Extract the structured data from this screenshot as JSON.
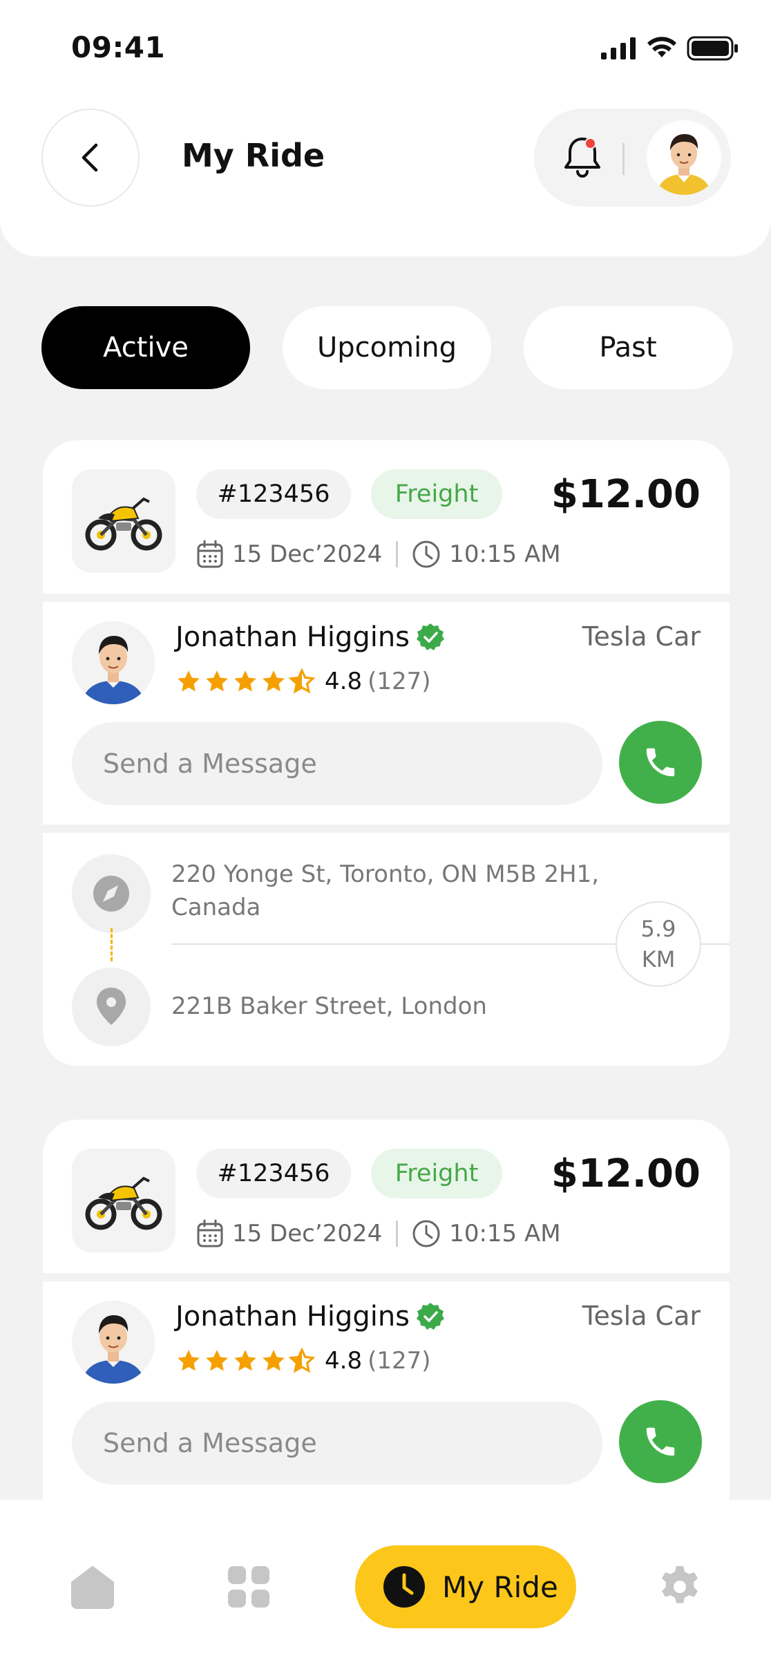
{
  "status_bar": {
    "time": "09:41"
  },
  "header": {
    "title": "My Ride"
  },
  "tabs": [
    {
      "label": "Active",
      "active": true
    },
    {
      "label": "Upcoming",
      "active": false
    },
    {
      "label": "Past",
      "active": false
    }
  ],
  "rides": [
    {
      "id": "#123456",
      "type": "Freight",
      "price": "$12.00",
      "date": "15 Dec’2024",
      "time": "10:15 AM",
      "driver": {
        "name": "Jonathan Higgins",
        "vehicle": "Tesla Car",
        "rating": "4.8",
        "reviews": "(127)",
        "stars": 4.5
      },
      "message_placeholder": "Send a Message",
      "pickup": "220 Yonge St, Toronto, ON M5B 2H1, Canada",
      "dropoff": "221B Baker Street, London",
      "distance_value": "5.9",
      "distance_unit": "KM"
    },
    {
      "id": "#123456",
      "type": "Freight",
      "price": "$12.00",
      "date": "15 Dec’2024",
      "time": "10:15 AM",
      "driver": {
        "name": "Jonathan Higgins",
        "vehicle": "Tesla Car",
        "rating": "4.8",
        "reviews": "(127)",
        "stars": 4.5
      },
      "message_placeholder": "Send a Message"
    }
  ],
  "bottom_nav": {
    "items": [
      "home-icon",
      "grid-icon",
      "clock-icon",
      "gear-icon"
    ],
    "active_label": "My Ride"
  },
  "colors": {
    "accent": "#FCC71A",
    "call_green": "#42B04A",
    "freight_text": "#44A848",
    "freight_bg": "#E8F5E9",
    "star": "#F5A000"
  }
}
